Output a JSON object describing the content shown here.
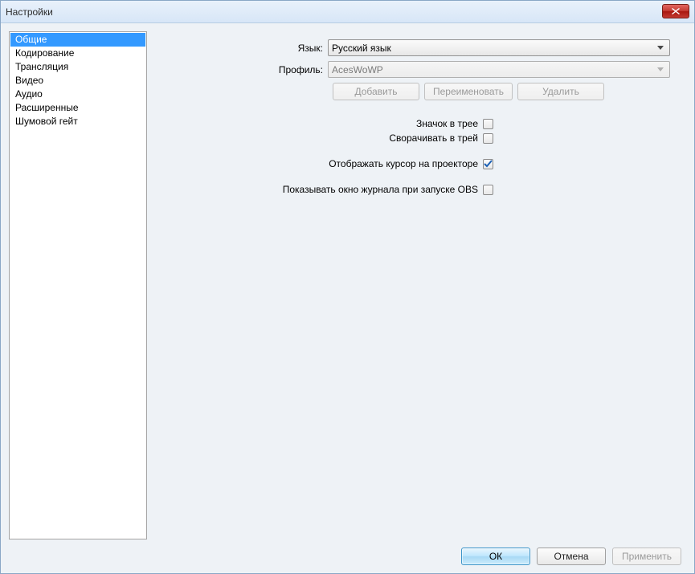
{
  "window": {
    "title": "Настройки"
  },
  "sidebar": {
    "items": [
      {
        "label": "Общие",
        "selected": true
      },
      {
        "label": "Кодирование",
        "selected": false
      },
      {
        "label": "Трансляция",
        "selected": false
      },
      {
        "label": "Видео",
        "selected": false
      },
      {
        "label": "Аудио",
        "selected": false
      },
      {
        "label": "Расширенные",
        "selected": false
      },
      {
        "label": "Шумовой гейт",
        "selected": false
      }
    ]
  },
  "main": {
    "language_label": "Язык:",
    "language_value": "Русский язык",
    "profile_label": "Профиль:",
    "profile_value": "AcesWoWP",
    "add_button": "Добавить",
    "rename_button": "Переименовать",
    "delete_button": "Удалить",
    "tray_icon_label": "Значок в трее",
    "tray_icon_checked": false,
    "minimize_tray_label": "Сворачивать в трей",
    "minimize_tray_checked": false,
    "cursor_label": "Отображать курсор на проекторе",
    "cursor_checked": true,
    "log_window_label": "Показывать окно журнала при запуске OBS",
    "log_window_checked": false
  },
  "footer": {
    "ok": "ОК",
    "cancel": "Отмена",
    "apply": "Применить"
  }
}
